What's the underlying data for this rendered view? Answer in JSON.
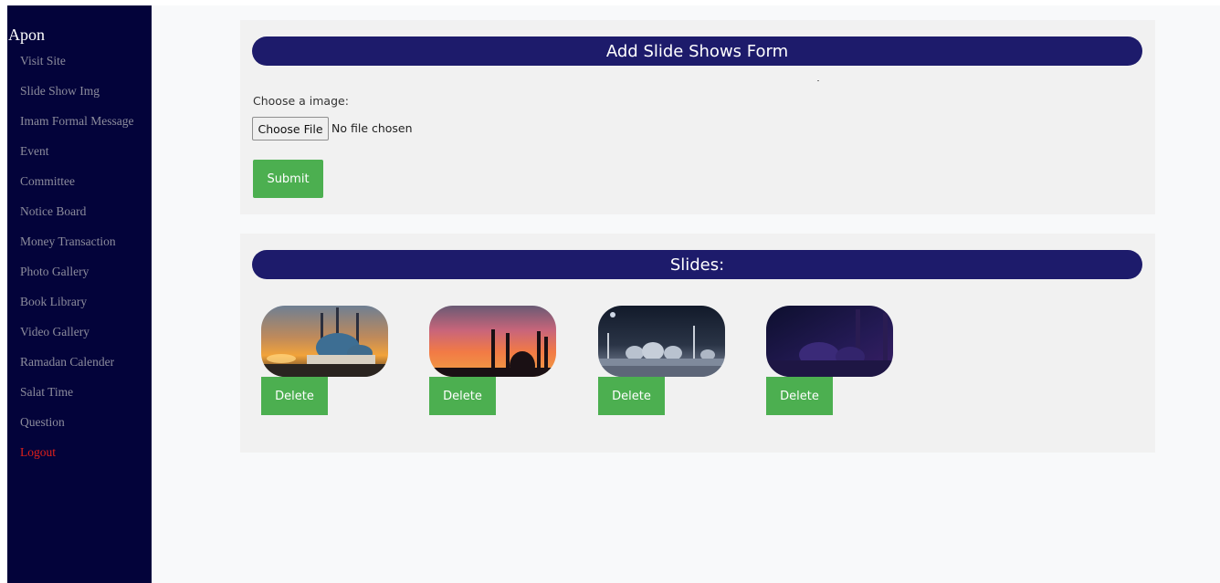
{
  "sidebar": {
    "brand": "Apon",
    "items": [
      {
        "label": "Visit Site"
      },
      {
        "label": "Slide Show Img"
      },
      {
        "label": "Imam Formal Message"
      },
      {
        "label": "Event"
      },
      {
        "label": "Committee"
      },
      {
        "label": "Notice Board"
      },
      {
        "label": "Money Transaction"
      },
      {
        "label": "Photo Gallery"
      },
      {
        "label": "Book Library"
      },
      {
        "label": "Video Gallery"
      },
      {
        "label": "Ramadan Calender"
      },
      {
        "label": "Salat Time"
      },
      {
        "label": "Question"
      }
    ],
    "logout": "Logout"
  },
  "form": {
    "title": "Add Slide Shows Form",
    "choose_label": "Choose a image:",
    "file_button": "Choose File",
    "file_status": "No file chosen",
    "submit": "Submit"
  },
  "slides": {
    "title": "Slides:",
    "items": [
      {
        "delete": "Delete"
      },
      {
        "delete": "Delete"
      },
      {
        "delete": "Delete"
      },
      {
        "delete": "Delete"
      }
    ]
  },
  "colors": {
    "sidebar": "#03033a",
    "header_pill": "#1d1b6b",
    "button": "#4caf50",
    "logout": "#e0201a"
  }
}
